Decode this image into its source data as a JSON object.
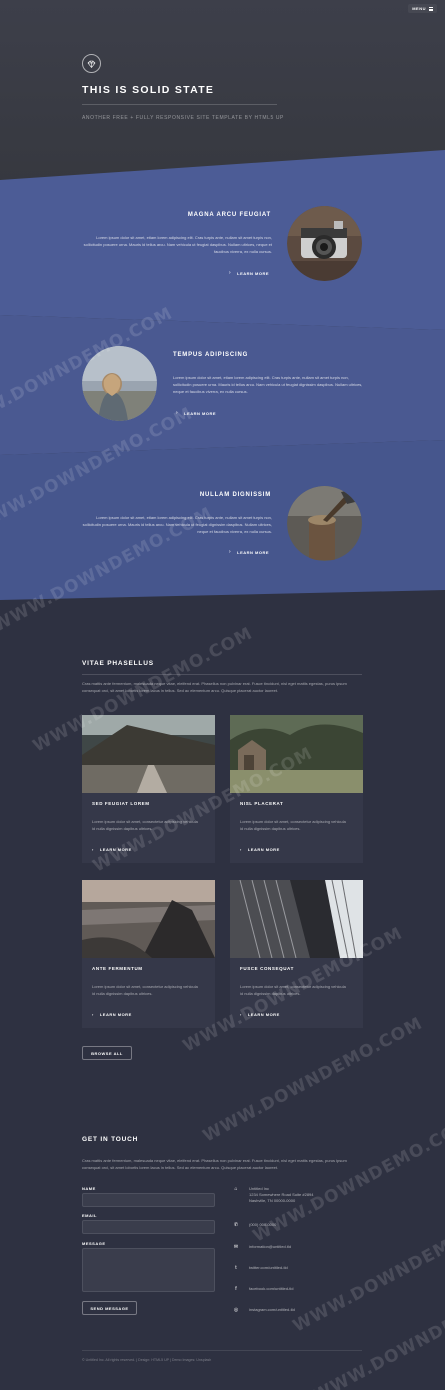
{
  "header": {
    "menu_label": "MENU",
    "menu_icon": "hamburger-icon",
    "logo_icon": "diamond-icon",
    "title": "THIS IS SOLID STATE",
    "tagline": "ANOTHER FREE + FULLY RESPONSIVE SITE TEMPLATE BY HTML5 UP"
  },
  "features": [
    {
      "title": "MAGNA ARCU FEUGIAT",
      "text": "Lorem ipsum dolor sit amet, etiam lorem adipiscing elit. Cras turpis ante, nullam sit amet turpis non, sollicitudin posuere urna. Mauris id tellus arcu. Nam vehicula ut feugiat daspibus. Nullam ultrices, neque et faucibus viverra, ex nulla cursus.",
      "link": "LEARN MORE",
      "image": "camera-photo"
    },
    {
      "title": "TEMPUS ADIPISCING",
      "text": "Lorem ipsum dolor sit amet, etiam lorem adipiscing elit. Cras turpis ante, nullam sit amet turpis non, sollicitudin posuere urna. Mauris id tellus arcu. Nam vehicula ut feugiat dignissim daspibus. Nullam ultrices, neque et faucibus viverra, ex nulla cursus.",
      "link": "LEARN MORE",
      "image": "woman-photo"
    },
    {
      "title": "NULLAM DIGNISSIM",
      "text": "Lorem ipsum dolor sit amet, etiam lorem adipiscing elit. Cras turpis ante, nullam sit amet turpis non, sollicitudin posuere urna. Mauris id tellus arcu. Nam vehicula ut feugiat dignissim daspibus. Nullam ultrices, neque et faucibus viverra, ex nulla cursus.",
      "link": "LEARN MORE",
      "image": "axe-photo"
    }
  ],
  "vitae": {
    "title": "VITAE PHASELLUS",
    "text": "Cras mattis ante fermentum, malesuada neque vitae, eleifend erat. Phasellus non pulvinar erat. Fusce tincidunt, nisl eget mattis egestas, purus ipsum consequat orci, sit amet lobortis lorem lacus in tellus. Sed ac elementum arcu. Quisque placerat auctor laoreet.",
    "cards": [
      {
        "title": "SED FEUGIAT LOREM",
        "text": "Lorem ipsum dolor sit amet, consectetur adipiscing vehicula id nulla dignissim dapibus ultrices.",
        "link": "LEARN MORE"
      },
      {
        "title": "NISL PLACERAT",
        "text": "Lorem ipsum dolor sit amet, consectetur adipiscing vehicula id nulla dignissim dapibus ultrices.",
        "link": "LEARN MORE"
      },
      {
        "title": "ANTE FERMENTUM",
        "text": "Lorem ipsum dolor sit amet, consectetur adipiscing vehicula id nulla dignissim dapibus ultrices.",
        "link": "LEARN MORE"
      },
      {
        "title": "FUSCE CONSEQUAT",
        "text": "Lorem ipsum dolor sit amet, consectetur adipiscing vehicula id nulla dignissim dapibus ultrices.",
        "link": "LEARN MORE"
      }
    ],
    "browse_all": "BROWSE ALL"
  },
  "contact": {
    "title": "GET IN TOUCH",
    "text": "Cras mattis ante fermentum, malesuada neque vitae, eleifend erat. Phasellus non pulvinar erat. Fusce tincidunt, nisl eget mattis egestas, purus ipsum consequat orci, sit amet lobortis lorem lacus in tellus. Sed ac elementum arcu. Quisque placerat auctor laoreet.",
    "name_label": "NAME",
    "email_label": "EMAIL",
    "message_label": "MESSAGE",
    "send_label": "SEND MESSAGE",
    "address_lines": [
      "Untitled Inc",
      "1234 Somewhere Road Suite #2894",
      "Nashville, TN 00000-0000"
    ],
    "phone": "(000) 000-0000",
    "email": "information@untitled.tld",
    "twitter": "twitter.com/untitled-tld",
    "facebook": "facebook.com/untitled-tld",
    "instagram": "instagram.com/untitled-tld",
    "copyright": "© Untitled Inc. All rights reserved.  |  Design: HTML5 UP  |  Demo Images: Unsplash"
  },
  "watermark_text": "WWW.DOWNDEMO.COM"
}
